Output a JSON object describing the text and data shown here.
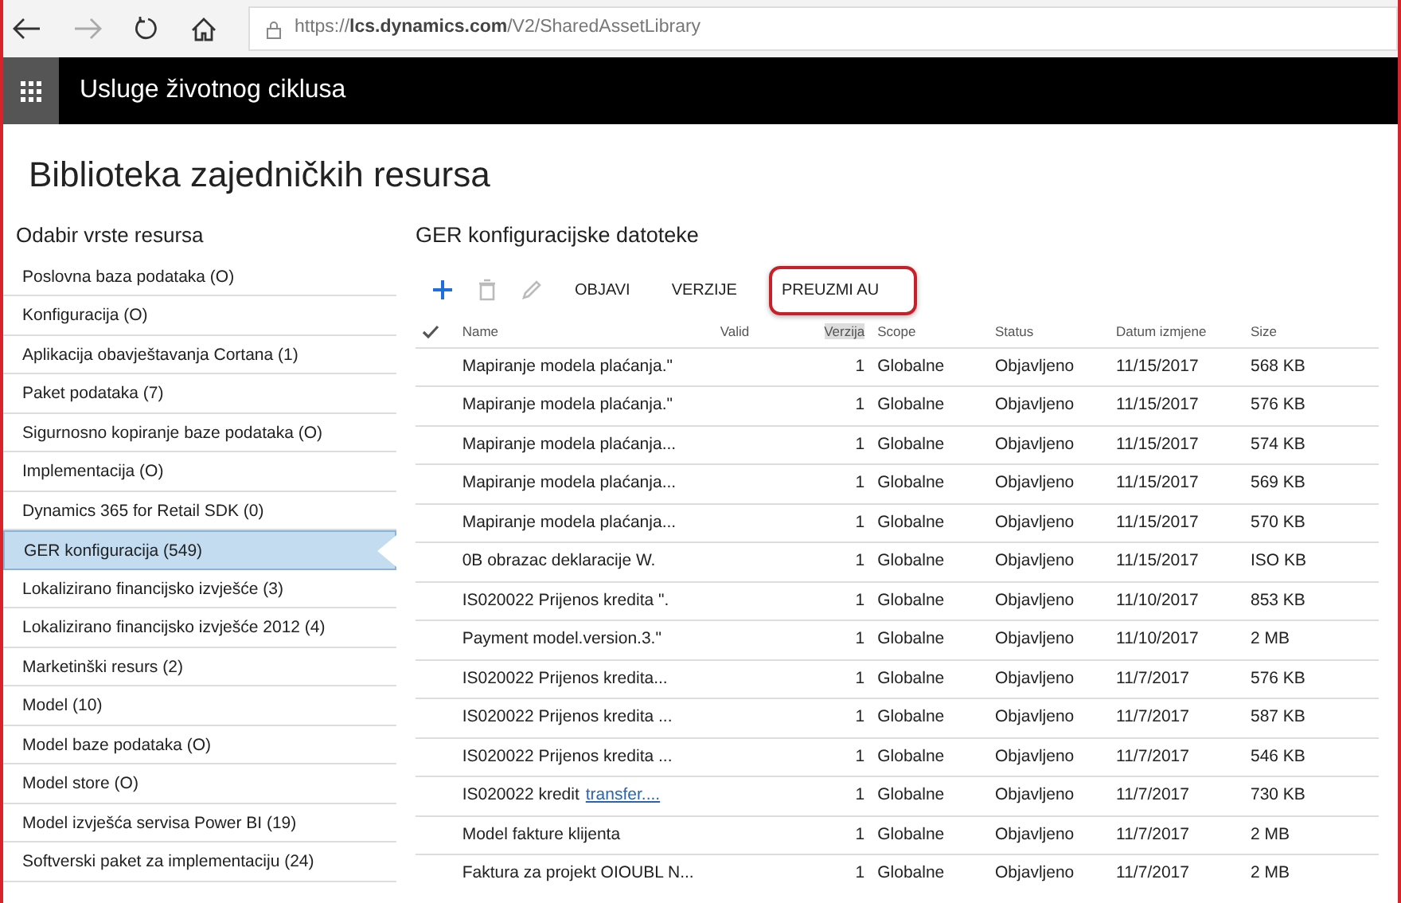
{
  "browser": {
    "url_prefix": "https://",
    "url_host": "lcs.dynamics.com",
    "url_path": "/V2/SharedAssetLibrary"
  },
  "app_bar": {
    "title": "Usluge životnog ciklusa"
  },
  "page_title": "Biblioteka zajedničkih resursa",
  "sidebar": {
    "heading": "Odabir vrste resursa",
    "items": [
      {
        "label": "Poslovna baza podataka (O)",
        "selected": false
      },
      {
        "label": "Konfiguracija (O)",
        "selected": false
      },
      {
        "label": "Aplikacija obavještavanja Cortana (1)",
        "selected": false
      },
      {
        "label": "Paket podataka (7)",
        "selected": false
      },
      {
        "label": "Sigurnosno kopiranje baze podataka (O)",
        "selected": false
      },
      {
        "label": "Implementacija (O)",
        "selected": false
      },
      {
        "label": "Dynamics 365 for Retail SDK (0)",
        "selected": false
      },
      {
        "label": "GER konfiguracija (549)",
        "selected": true
      },
      {
        "label": "Lokalizirano financijsko izvješće (3)",
        "selected": false
      },
      {
        "label": "Lokalizirano financijsko izvješće 2012 (4)",
        "selected": false
      },
      {
        "label": "Marketinški resurs (2)",
        "selected": false
      },
      {
        "label": "Model (10)",
        "selected": false
      },
      {
        "label": "Model baze podataka (O)",
        "selected": false
      },
      {
        "label": "Model store (O)",
        "selected": false
      },
      {
        "label": "Model izvješća servisa Power BI (19)",
        "selected": false
      },
      {
        "label": "Softverski paket za implementaciju (24)",
        "selected": false
      }
    ]
  },
  "content": {
    "heading": "GER konfiguracijske datoteke",
    "toolbar": [
      {
        "kind": "add",
        "disabled": false
      },
      {
        "kind": "delete",
        "disabled": true
      },
      {
        "kind": "edit",
        "disabled": true
      },
      {
        "kind": "text",
        "label": "OBJAVI",
        "highlighted": false
      },
      {
        "kind": "text",
        "label": "VERZIJE",
        "highlighted": false
      },
      {
        "kind": "text",
        "label": "PREUZMI AU",
        "highlighted": true
      }
    ],
    "table": {
      "columns": [
        "Name",
        "Valid",
        "Verzija",
        "Scope",
        "Status",
        "Datum izmjene",
        "Size"
      ],
      "rows": [
        {
          "name": "Mapiranje modela plaćanja.\"",
          "version": "1",
          "scope": "Globalne",
          "status": "Objavljeno",
          "date": "11/15/2017",
          "size": "568 KB"
        },
        {
          "name": "Mapiranje modela plaćanja.\"",
          "version": "1",
          "scope": "Globalne",
          "status": "Objavljeno",
          "date": "11/15/2017",
          "size": "576 KB"
        },
        {
          "name": "Mapiranje modela plaćanja...",
          "version": "1",
          "scope": "Globalne",
          "status": "Objavljeno",
          "date": "11/15/2017",
          "size": "574 KB"
        },
        {
          "name": "Mapiranje modela plaćanja...",
          "version": "1",
          "scope": "Globalne",
          "status": "Objavljeno",
          "date": "11/15/2017",
          "size": "569 KB"
        },
        {
          "name": "Mapiranje modela plaćanja...",
          "version": "1",
          "scope": "Globalne",
          "status": "Objavljeno",
          "date": "11/15/2017",
          "size": "570 KB"
        },
        {
          "name": "0B obrazac deklaracije W.",
          "version": "1",
          "scope": "Globalne",
          "status": "Objavljeno",
          "date": "11/15/2017",
          "size": "ISO KB"
        },
        {
          "name": "IS020022 Prijenos kredita \".",
          "version": "1",
          "scope": "Globalne",
          "status": "Objavljeno",
          "date": "11/10/2017",
          "size": "853 KB"
        },
        {
          "name": "Payment model.version.3.\"",
          "version": "1",
          "scope": "Globalne",
          "status": "Objavljeno",
          "date": "11/10/2017",
          "size": "2 MB"
        },
        {
          "name": "IS020022 Prijenos kredita...",
          "version": "1",
          "scope": "Globalne",
          "status": "Objavljeno",
          "date": "11/7/2017",
          "size": "576 KB"
        },
        {
          "name": "IS020022 Prijenos kredita ...",
          "version": "1",
          "scope": "Globalne",
          "status": "Objavljeno",
          "date": "11/7/2017",
          "size": "587 KB"
        },
        {
          "name": "IS020022 Prijenos kredita ...",
          "version": "1",
          "scope": "Globalne",
          "status": "Objavljeno",
          "date": "11/7/2017",
          "size": "546 KB"
        },
        {
          "name": "IS020022 kredit",
          "link": "transfer....",
          "version": "1",
          "scope": "Globalne",
          "status": "Objavljeno",
          "date": "11/7/2017",
          "size": "730 KB"
        },
        {
          "name": "Model fakture klijenta",
          "version": "1",
          "scope": "Globalne",
          "status": "Objavljeno",
          "date": "11/7/2017",
          "size": "2 MB"
        },
        {
          "name": "Faktura za projekt OIOUBL N...",
          "version": "1",
          "scope": "Globalne",
          "status": "Objavljeno",
          "date": "11/7/2017",
          "size": "2 MB"
        }
      ]
    }
  }
}
